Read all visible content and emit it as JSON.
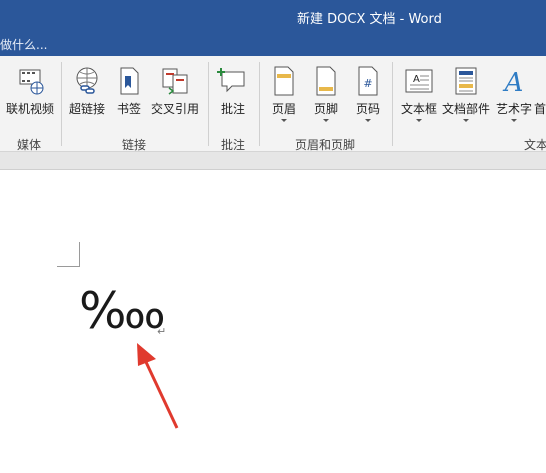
{
  "window": {
    "title": "新建 DOCX 文档 - Word"
  },
  "tell_me": {
    "text": "做什么..."
  },
  "ribbon": {
    "buttons": [
      {
        "label": "联机视频",
        "icon": "online-video-icon"
      },
      {
        "label": "超链接",
        "icon": "hyperlink-icon"
      },
      {
        "label": "书签",
        "icon": "bookmark-icon"
      },
      {
        "label": "交叉引用",
        "icon": "cross-reference-icon"
      },
      {
        "label": "批注",
        "icon": "comment-icon"
      },
      {
        "label": "页眉",
        "icon": "header-icon"
      },
      {
        "label": "页脚",
        "icon": "footer-icon"
      },
      {
        "label": "页码",
        "icon": "page-number-icon"
      },
      {
        "label": "文本框",
        "icon": "text-box-icon"
      },
      {
        "label": "文档部件",
        "icon": "quick-parts-icon"
      },
      {
        "label": "艺术字",
        "icon": "wordart-icon"
      },
      {
        "label": "首",
        "icon": "drop-cap-icon"
      }
    ],
    "groups": [
      {
        "label": "媒体"
      },
      {
        "label": "链接"
      },
      {
        "label": "批注"
      },
      {
        "label": "页眉和页脚"
      },
      {
        "label": "文本"
      }
    ]
  },
  "document": {
    "content": "‱",
    "paragraph_mark": "↵"
  },
  "colors": {
    "titlebar": "#2b579a",
    "ribbon": "#f3f3f3",
    "annotation_arrow": "#e03a2e"
  }
}
